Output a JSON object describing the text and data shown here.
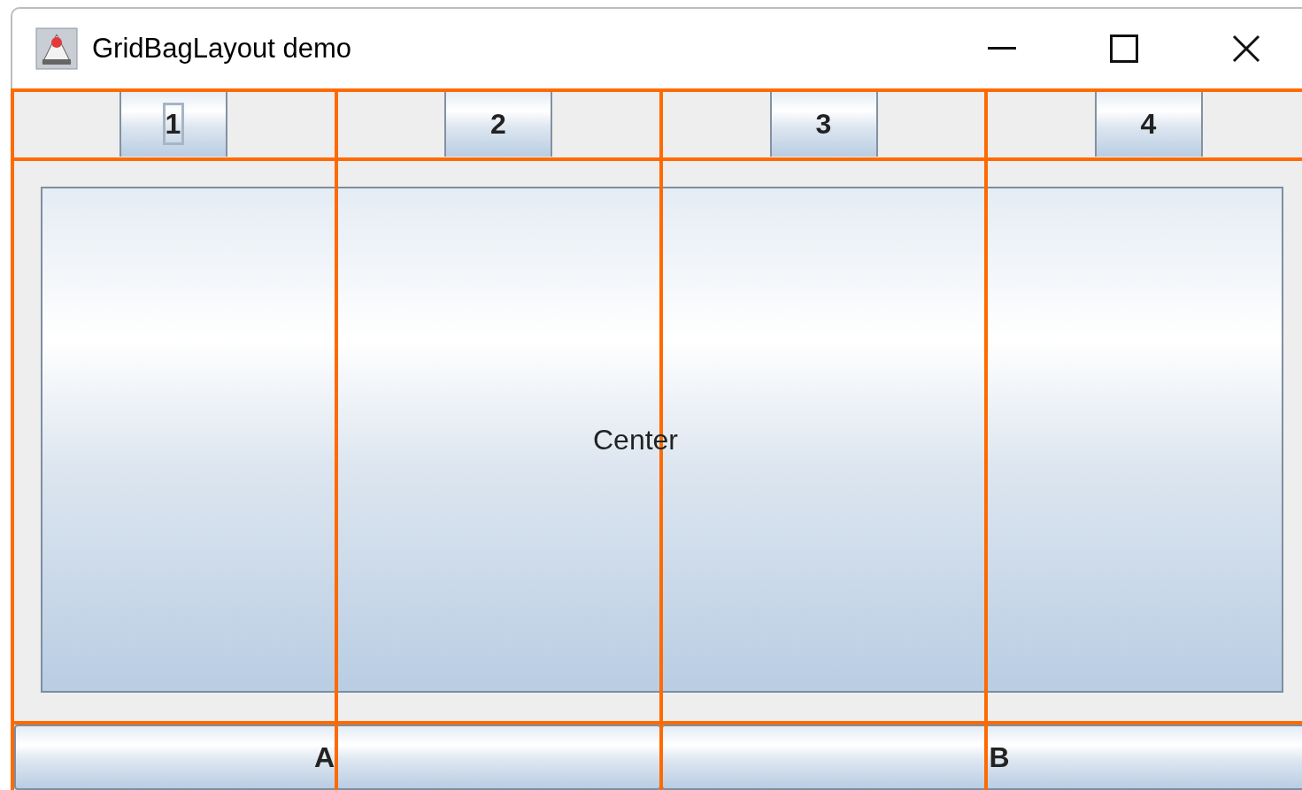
{
  "window": {
    "title": "GridBagLayout demo"
  },
  "top_buttons": [
    {
      "label": "1",
      "focused": true
    },
    {
      "label": "2",
      "focused": false
    },
    {
      "label": "3",
      "focused": false
    },
    {
      "label": "4",
      "focused": false
    }
  ],
  "center_button": {
    "label": "Center"
  },
  "bottom_buttons": [
    {
      "label": "A"
    },
    {
      "label": "B"
    }
  ]
}
